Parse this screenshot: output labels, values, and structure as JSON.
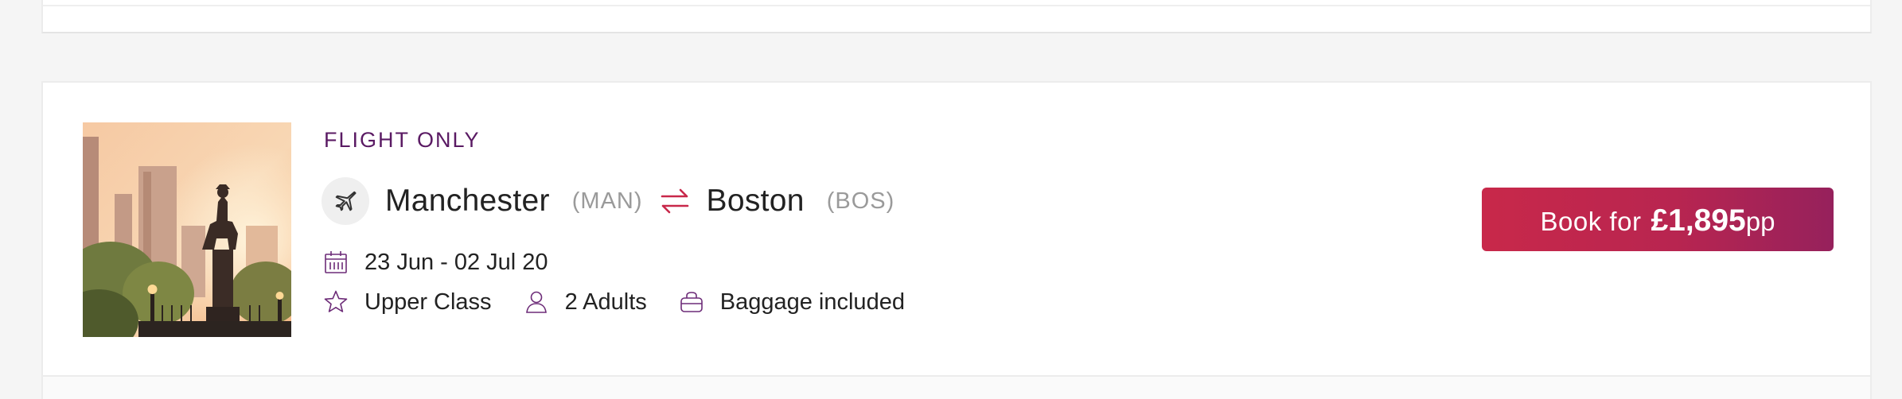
{
  "result": {
    "product_type": "FLIGHT ONLY",
    "origin": {
      "city": "Manchester",
      "code": "(MAN)"
    },
    "destination": {
      "city": "Boston",
      "code": "(BOS)"
    },
    "dates": "23 Jun - 02 Jul 20",
    "cabin": "Upper Class",
    "passengers": "2 Adults",
    "baggage": "Baggage included",
    "book": {
      "label": "Book for",
      "price": "£1,895",
      "suffix": "pp"
    }
  },
  "icons": {
    "plane": "airplane-icon",
    "swap": "return-arrows-icon",
    "calendar": "calendar-icon",
    "cabin": "star-icon",
    "passengers": "person-icon",
    "baggage": "bag-icon"
  },
  "colors": {
    "accent_purple": "#5a1a63",
    "icon_purple": "#6d2c78",
    "swap_red": "#c8284a",
    "button_start": "#c8284a",
    "button_end": "#96215c"
  }
}
